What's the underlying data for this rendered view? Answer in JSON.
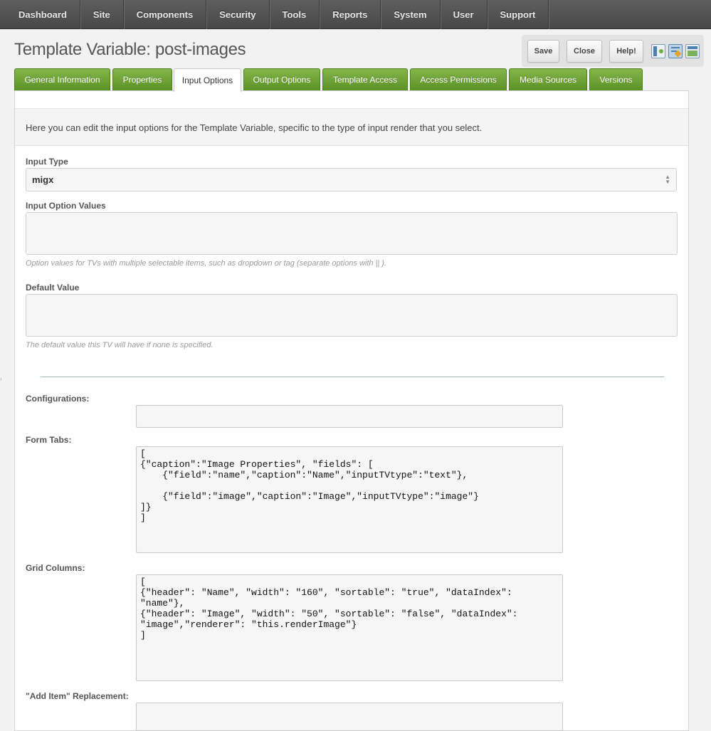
{
  "nav": {
    "items": [
      "Dashboard",
      "Site",
      "Components",
      "Security",
      "Tools",
      "Reports",
      "System",
      "User",
      "Support"
    ]
  },
  "page": {
    "title": "Template Variable: post-images"
  },
  "actions": {
    "save_label": "Save",
    "close_label": "Close",
    "help_label": "Help!"
  },
  "tabs": [
    {
      "label": "General Information"
    },
    {
      "label": "Properties"
    },
    {
      "label": "Input Options"
    },
    {
      "label": "Output Options"
    },
    {
      "label": "Template Access"
    },
    {
      "label": "Access Permissions"
    },
    {
      "label": "Media Sources"
    },
    {
      "label": "Versions"
    }
  ],
  "active_tab": "Input Options",
  "panel": {
    "description": "Here you can edit the input options for the Template Variable, specific to the type of input render that you select."
  },
  "form": {
    "input_type_label": "Input Type",
    "input_type_value": "migx",
    "option_values_label": "Input Option Values",
    "option_values_help": "Option values for TVs with multiple selectable items, such as dropdown or tag (separate options with || ).",
    "default_value_label": "Default Value",
    "default_value_help": "The default value this TV will have if none is specified.",
    "configurations_label": "Configurations:",
    "configurations_value": "",
    "form_tabs_label": "Form Tabs:",
    "form_tabs_value": "[\n{\"caption\":\"Image Properties\", \"fields\": [\n    {\"field\":\"name\",\"caption\":\"Name\",\"inputTVtype\":\"text\"},\n\n    {\"field\":\"image\",\"caption\":\"Image\",\"inputTVtype\":\"image\"}\n]}\n]",
    "grid_columns_label": "Grid Columns:",
    "grid_columns_value": "[\n{\"header\": \"Name\", \"width\": \"160\", \"sortable\": \"true\", \"dataIndex\":\n\"name\"},\n{\"header\": \"Image\", \"width\": \"50\", \"sortable\": \"false\", \"dataIndex\":\n\"image\",\"renderer\": \"this.renderImage\"}\n]",
    "add_item_label": "\"Add Item\" Replacement:"
  },
  "colors": {
    "tab_green": "#6aa232",
    "nav_dark": "#525252"
  }
}
